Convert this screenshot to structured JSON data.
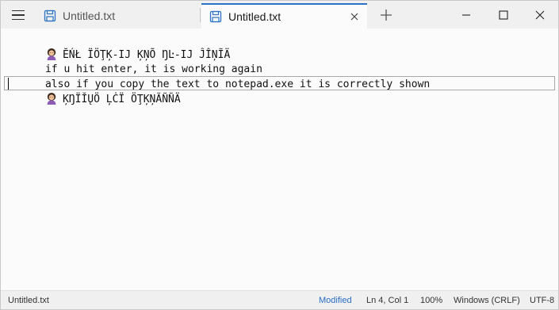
{
  "tabs": [
    {
      "label": "Untitled.txt",
      "active": false
    },
    {
      "label": "Untitled.txt",
      "active": true
    }
  ],
  "editor": {
    "lines": [
      {
        "emoji": "person-emoji",
        "text": "ĔŃŁ ÏÖŢĶ-IJ ĶŅÕ ŊĿ-IJ ĴÎŅĨÄ"
      },
      {
        "text": "if u hit enter, it is working again"
      },
      {
        "text": "also if you copy the text to notepad.exe it is correctly shown"
      },
      {
        "emoji": "person-emoji",
        "text": "ĶŊÏĬŲÖ ĻĊÏ ÖŢĶŅÃÑÑÄ"
      }
    ],
    "current_line": 4
  },
  "statusbar": {
    "file": "Untitled.txt",
    "modified": "Modified",
    "position": "Ln 4, Col 1",
    "zoom": "100%",
    "line_ending": "Windows (CRLF)",
    "encoding": "UTF-8"
  },
  "colors": {
    "accent": "#2b72c6",
    "titlebar_bg": "#f0f0f0",
    "editor_bg": "#fbfbfb",
    "modified_text": "#2a6cc4"
  }
}
